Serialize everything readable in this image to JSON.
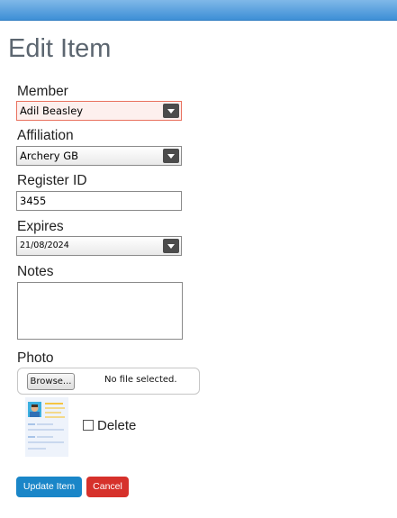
{
  "header": {
    "title": "Edit Item"
  },
  "form": {
    "member": {
      "label": "Member",
      "value": "Adil Beasley"
    },
    "affiliation": {
      "label": "Affiliation",
      "value": "Archery GB"
    },
    "register_id": {
      "label": "Register ID",
      "value": "3455"
    },
    "expires": {
      "label": "Expires",
      "value": "21/08/2024"
    },
    "notes": {
      "label": "Notes",
      "value": ""
    },
    "photo": {
      "label": "Photo",
      "browse_label": "Browse...",
      "status": "No file selected.",
      "delete_label": "Delete"
    }
  },
  "actions": {
    "update_label": "Update Item",
    "cancel_label": "Cancel"
  },
  "colors": {
    "topbar": "#3e8fd6",
    "update_button": "#1a86c8",
    "cancel_button": "#d6312b",
    "error_border": "#e9725f"
  }
}
